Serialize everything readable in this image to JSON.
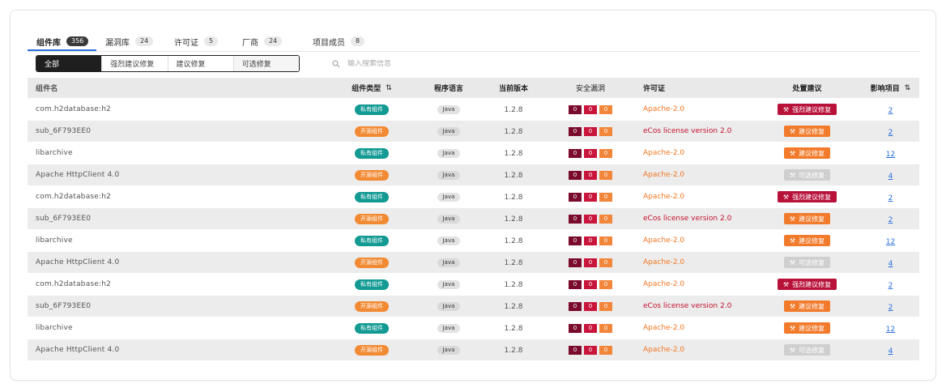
{
  "tabs": [
    {
      "label": "组件库",
      "count": "356"
    },
    {
      "label": "漏洞库",
      "count": "24"
    },
    {
      "label": "许可证",
      "count": "5"
    },
    {
      "label": "厂商",
      "count": "24"
    },
    {
      "label": "项目成员",
      "count": "8"
    }
  ],
  "filter": [
    "全部",
    "强烈建议修复",
    "建议修复",
    "可选修复"
  ],
  "search": {
    "placeholder": "输入搜索信息"
  },
  "headers": {
    "name": "组件名",
    "type": "组件类型",
    "lang": "程序语言",
    "version": "当前版本",
    "vuln": "安全漏洞",
    "license": "许可证",
    "advice": "处置建议",
    "projects": "影响项目"
  },
  "colors": {
    "private": "#129a93",
    "open": "#f28a33",
    "critical": "#7a0b2c",
    "high": "#c9153c",
    "medium": "#f2863b",
    "strong_fix": "#b8113a",
    "suggest_fix": "#f27a2b",
    "optional_fix": "#cfcfcf",
    "link": "#2a6fdb"
  },
  "rows": [
    {
      "name": "com.h2database:h2",
      "type": "私有组件",
      "type_kind": "private",
      "lang": "Java",
      "version": "1.2.8",
      "vulns": [
        "0",
        "0",
        "0"
      ],
      "license": "Apache-2.0",
      "license_kind": "orange",
      "advice": "强烈建议修复",
      "advice_kind": "strong",
      "projects": "2"
    },
    {
      "name": "sub_6F793EE0",
      "type": "开源组件",
      "type_kind": "open",
      "lang": "Java",
      "version": "1.2.8",
      "vulns": [
        "0",
        "0",
        "0"
      ],
      "license": "eCos license version 2.0",
      "license_kind": "red",
      "advice": "建议修复",
      "advice_kind": "suggest",
      "projects": "2"
    },
    {
      "name": "libarchive",
      "type": "私有组件",
      "type_kind": "private",
      "lang": "Java",
      "version": "1.2.8",
      "vulns": [
        "0",
        "0",
        "0"
      ],
      "license": "Apache-2.0",
      "license_kind": "orange",
      "advice": "建议修复",
      "advice_kind": "suggest",
      "projects": "12"
    },
    {
      "name": "Apache HttpClient 4.0",
      "type": "开源组件",
      "type_kind": "open",
      "lang": "Java",
      "version": "1.2.8",
      "vulns": [
        "0",
        "0",
        "0"
      ],
      "license": "Apache-2.0",
      "license_kind": "orange",
      "advice": "可选修复",
      "advice_kind": "optional",
      "projects": "4"
    },
    {
      "name": "com.h2database:h2",
      "type": "私有组件",
      "type_kind": "private",
      "lang": "Java",
      "version": "1.2.8",
      "vulns": [
        "0",
        "0",
        "0"
      ],
      "license": "Apache-2.0",
      "license_kind": "orange",
      "advice": "强烈建议修复",
      "advice_kind": "strong",
      "projects": "2"
    },
    {
      "name": "sub_6F793EE0",
      "type": "开源组件",
      "type_kind": "open",
      "lang": "Java",
      "version": "1.2.8",
      "vulns": [
        "0",
        "0",
        "0"
      ],
      "license": "eCos license version 2.0",
      "license_kind": "red",
      "advice": "建议修复",
      "advice_kind": "suggest",
      "projects": "2"
    },
    {
      "name": "libarchive",
      "type": "私有组件",
      "type_kind": "private",
      "lang": "Java",
      "version": "1.2.8",
      "vulns": [
        "0",
        "0",
        "0"
      ],
      "license": "Apache-2.0",
      "license_kind": "orange",
      "advice": "建议修复",
      "advice_kind": "suggest",
      "projects": "12"
    },
    {
      "name": "Apache HttpClient 4.0",
      "type": "开源组件",
      "type_kind": "open",
      "lang": "Java",
      "version": "1.2.8",
      "vulns": [
        "0",
        "0",
        "0"
      ],
      "license": "Apache-2.0",
      "license_kind": "orange",
      "advice": "可选修复",
      "advice_kind": "optional",
      "projects": "4"
    },
    {
      "name": "com.h2database:h2",
      "type": "私有组件",
      "type_kind": "private",
      "lang": "Java",
      "version": "1.2.8",
      "vulns": [
        "0",
        "0",
        "0"
      ],
      "license": "Apache-2.0",
      "license_kind": "orange",
      "advice": "强烈建议修复",
      "advice_kind": "strong",
      "projects": "2"
    },
    {
      "name": "sub_6F793EE0",
      "type": "开源组件",
      "type_kind": "open",
      "lang": "Java",
      "version": "1.2.8",
      "vulns": [
        "0",
        "0",
        "0"
      ],
      "license": "eCos license version 2.0",
      "license_kind": "red",
      "advice": "建议修复",
      "advice_kind": "suggest",
      "projects": "2"
    },
    {
      "name": "libarchive",
      "type": "私有组件",
      "type_kind": "private",
      "lang": "Java",
      "version": "1.2.8",
      "vulns": [
        "0",
        "0",
        "0"
      ],
      "license": "Apache-2.0",
      "license_kind": "orange",
      "advice": "建议修复",
      "advice_kind": "suggest",
      "projects": "12"
    },
    {
      "name": "Apache HttpClient 4.0",
      "type": "开源组件",
      "type_kind": "open",
      "lang": "Java",
      "version": "1.2.8",
      "vulns": [
        "0",
        "0",
        "0"
      ],
      "license": "Apache-2.0",
      "license_kind": "orange",
      "advice": "可选修复",
      "advice_kind": "optional",
      "projects": "4"
    }
  ]
}
